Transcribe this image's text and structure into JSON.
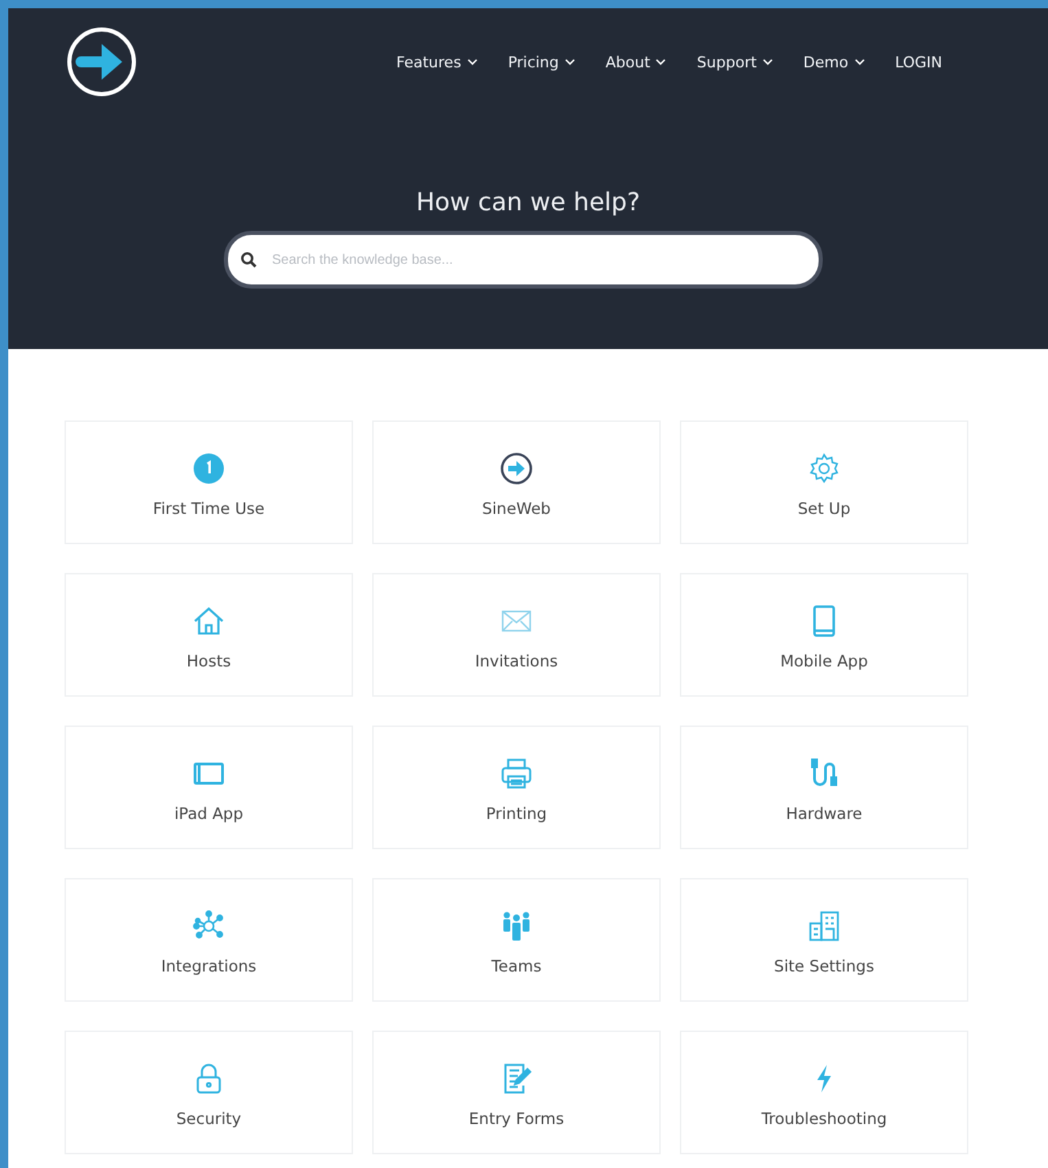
{
  "nav": {
    "items": [
      {
        "label": "Features",
        "dropdown": true
      },
      {
        "label": "Pricing",
        "dropdown": true
      },
      {
        "label": "About",
        "dropdown": true
      },
      {
        "label": "Support",
        "dropdown": true
      },
      {
        "label": "Demo",
        "dropdown": true
      },
      {
        "label": "LOGIN",
        "dropdown": false
      }
    ]
  },
  "hero": {
    "title": "How can we help?",
    "search": {
      "placeholder": "Search the knowledge base..."
    }
  },
  "categories": [
    {
      "label": "First Time Use"
    },
    {
      "label": "SineWeb"
    },
    {
      "label": "Set Up"
    },
    {
      "label": "Hosts"
    },
    {
      "label": "Invitations"
    },
    {
      "label": "Mobile App"
    },
    {
      "label": "iPad App"
    },
    {
      "label": "Printing"
    },
    {
      "label": "Hardware"
    },
    {
      "label": "Integrations"
    },
    {
      "label": "Teams"
    },
    {
      "label": "Site Settings"
    },
    {
      "label": "Security"
    },
    {
      "label": "Entry Forms"
    },
    {
      "label": "Troubleshooting"
    }
  ]
}
